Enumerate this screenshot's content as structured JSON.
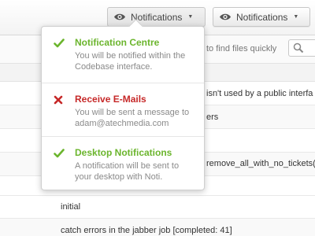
{
  "header": {
    "buttons": [
      {
        "label": "Notifications"
      },
      {
        "label": "Notifications"
      }
    ]
  },
  "search": {
    "hint_text": "to find files quickly"
  },
  "table": {
    "rows": [
      {
        "date": "",
        "text": "isn't used by a public interfa"
      },
      {
        "date": "",
        "text": "ers"
      },
      {
        "date": "",
        "text": ""
      },
      {
        "date": "",
        "text": "remove_all_with_no_tickets("
      },
      {
        "date": "",
        "text": ""
      },
      {
        "date": "",
        "text": "initial"
      },
      {
        "date": "",
        "text": "catch errors in the jabber job [completed: 41]"
      }
    ]
  },
  "dropdown": {
    "options": [
      {
        "title": "Notification Centre",
        "description": "You will be notified within the Codebase interface.",
        "status": "enabled",
        "color": "#6bb52d"
      },
      {
        "title": "Receive E-Mails",
        "description": "You will be sent a message to adam@atechmedia.com",
        "status": "disabled",
        "color": "#c62828"
      },
      {
        "title": "Desktop Notifications",
        "description": "A notification will be sent to your desktop with Noti.",
        "status": "enabled",
        "color": "#6bb52d"
      }
    ]
  },
  "icons": {
    "button_icon": "eye-icon",
    "caret": "caret-down-icon",
    "search": "search-icon",
    "enabled": "checkmark-icon",
    "disabled": "cross-icon"
  }
}
